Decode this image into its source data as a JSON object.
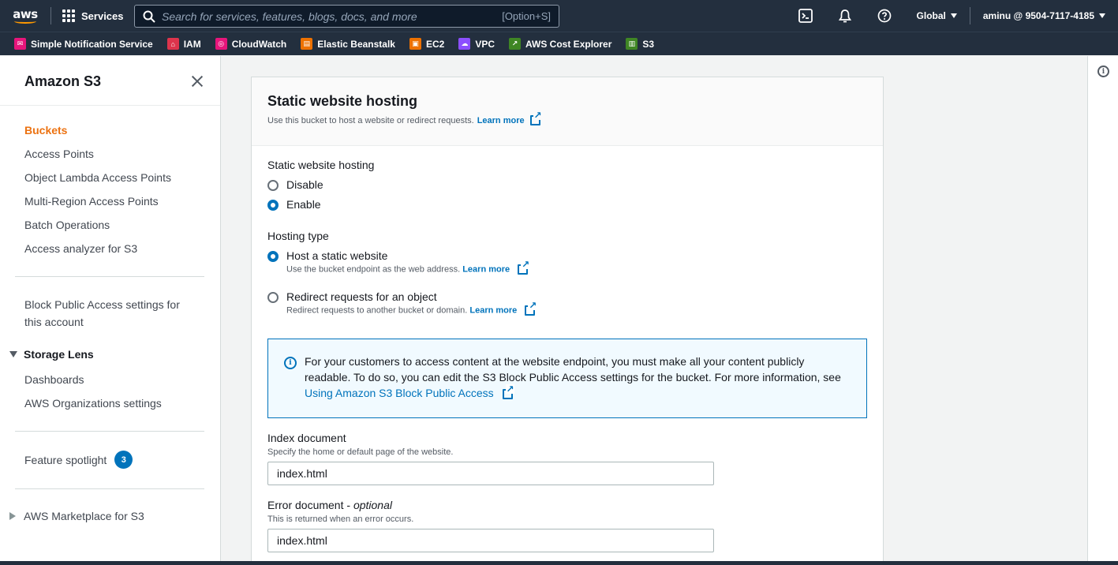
{
  "topnav": {
    "logo_text": "aws",
    "services_label": "Services",
    "search_placeholder": "Search for services, features, blogs, docs, and more",
    "search_shortcut": "[Option+S]",
    "region": "Global",
    "account": "aminu @ 9504-7117-4185"
  },
  "favorites": [
    {
      "label": "Simple Notification Service",
      "color": "#e7157b",
      "icon": "sns-icon"
    },
    {
      "label": "IAM",
      "color": "#dd344c",
      "icon": "iam-icon"
    },
    {
      "label": "CloudWatch",
      "color": "#e7157b",
      "icon": "cloudwatch-icon"
    },
    {
      "label": "Elastic Beanstalk",
      "color": "#ed7100",
      "icon": "beanstalk-icon"
    },
    {
      "label": "EC2",
      "color": "#ed7100",
      "icon": "ec2-icon"
    },
    {
      "label": "VPC",
      "color": "#8c4fff",
      "icon": "vpc-icon"
    },
    {
      "label": "AWS Cost Explorer",
      "color": "#3f8624",
      "icon": "cost-explorer-icon"
    },
    {
      "label": "S3",
      "color": "#3f8624",
      "icon": "s3-icon"
    }
  ],
  "sidebar": {
    "title": "Amazon S3",
    "links": [
      {
        "label": "Buckets"
      },
      {
        "label": "Access Points"
      },
      {
        "label": "Object Lambda Access Points"
      },
      {
        "label": "Multi-Region Access Points"
      },
      {
        "label": "Batch Operations"
      },
      {
        "label": "Access analyzer for S3"
      }
    ],
    "block_public_access_line1": "Block Public Access settings for",
    "block_public_access_line2": "this account",
    "storage_lens": {
      "label": "Storage Lens",
      "items": [
        {
          "label": "Dashboards"
        },
        {
          "label": "AWS Organizations settings"
        }
      ]
    },
    "feature_spotlight": {
      "label": "Feature spotlight",
      "count": "3"
    },
    "marketplace": "AWS Marketplace for S3"
  },
  "main": {
    "title": "Static website hosting",
    "description": "Use this bucket to host a website or redirect requests.",
    "learn_more": "Learn more",
    "hosting_label": "Static website hosting",
    "hosting_options": [
      {
        "label": "Disable",
        "selected": false
      },
      {
        "label": "Enable",
        "selected": true
      }
    ],
    "hosting_type_label": "Hosting type",
    "hosting_types": [
      {
        "label": "Host a static website",
        "description": "Use the bucket endpoint as the web address.",
        "learn_more": "Learn more",
        "selected": true
      },
      {
        "label": "Redirect requests for an object",
        "description": "Redirect requests to another bucket or domain.",
        "learn_more": "Learn more",
        "selected": false
      }
    ],
    "alert": {
      "line1": "For your customers to access content at the website endpoint, you must make all your content publicly",
      "line2": "readable. To do so, you can edit the S3 Block Public Access settings for the bucket. For more information, see",
      "link": "Using Amazon S3 Block Public Access"
    },
    "index_document": {
      "label": "Index document",
      "hint": "Specify the home or default page of the website.",
      "value": "index.html"
    },
    "error_document": {
      "label": "Error document - ",
      "optional": "optional",
      "hint": "This is returned when an error occurs.",
      "value": "index.html"
    }
  },
  "colors": {
    "nav_bg": "#232f3e",
    "active_link": "#ec7211",
    "link": "#0073bb",
    "alert_bg": "#f1faff"
  }
}
